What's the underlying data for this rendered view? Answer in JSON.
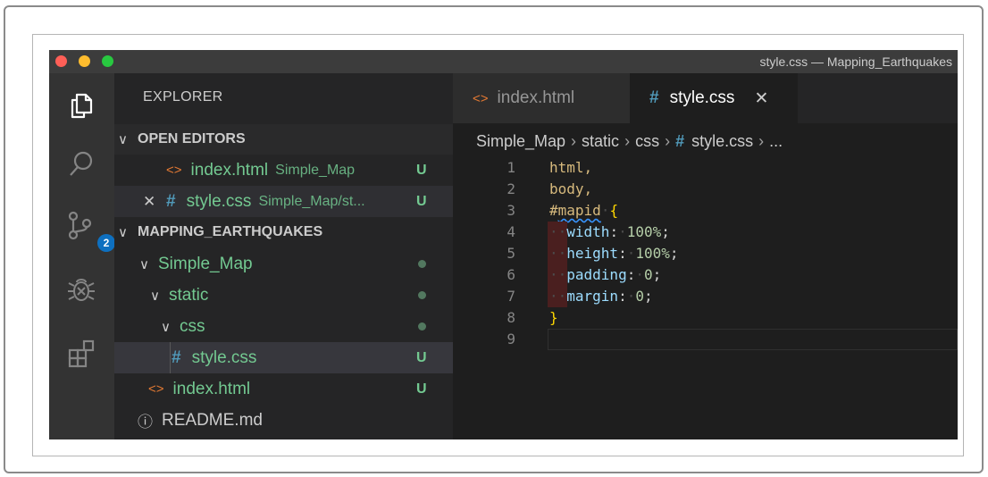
{
  "window": {
    "title": "style.css — Mapping_Earthquakes"
  },
  "activity_bar": {
    "icons": [
      "files-icon",
      "search-icon",
      "source-control-icon",
      "debug-icon",
      "extensions-icon"
    ],
    "source_control_badge": "2",
    "badge_color": "#0e70c0"
  },
  "sidebar": {
    "title": "EXPLORER",
    "open_editors": {
      "header": "OPEN EDITORS",
      "items": [
        {
          "name": "index.html",
          "description": "Simple_Map",
          "status": "U"
        },
        {
          "name": "style.css",
          "description": "Simple_Map/st...",
          "status": "U"
        }
      ]
    },
    "workspace": {
      "header": "MAPPING_EARTHQUAKES",
      "tree": [
        {
          "name": "Simple_Map"
        },
        {
          "name": "static"
        },
        {
          "name": "css"
        },
        {
          "name": "style.css",
          "status": "U"
        },
        {
          "name": "index.html",
          "status": "U"
        },
        {
          "name": "README.md"
        }
      ]
    }
  },
  "editor": {
    "tabs": [
      {
        "label": "index.html"
      },
      {
        "label": "style.css"
      }
    ],
    "breadcrumb": [
      "Simple_Map",
      "static",
      "css",
      "style.css",
      "..."
    ],
    "lines": [
      {
        "n": "1",
        "selector": "html,"
      },
      {
        "n": "2",
        "selector": "body,"
      },
      {
        "n": "3",
        "hash": "#",
        "id": "mapid",
        "brace": "{"
      },
      {
        "n": "4",
        "prop": "width",
        "value": "100%"
      },
      {
        "n": "5",
        "prop": "height",
        "value": "100%"
      },
      {
        "n": "6",
        "prop": "padding",
        "value": "0"
      },
      {
        "n": "7",
        "prop": "margin",
        "value": "0"
      },
      {
        "n": "8",
        "brace": "}"
      },
      {
        "n": "9"
      }
    ]
  },
  "colors": {
    "untracked": "#73c991",
    "html_icon": "#e37933",
    "css_icon": "#519aba"
  }
}
